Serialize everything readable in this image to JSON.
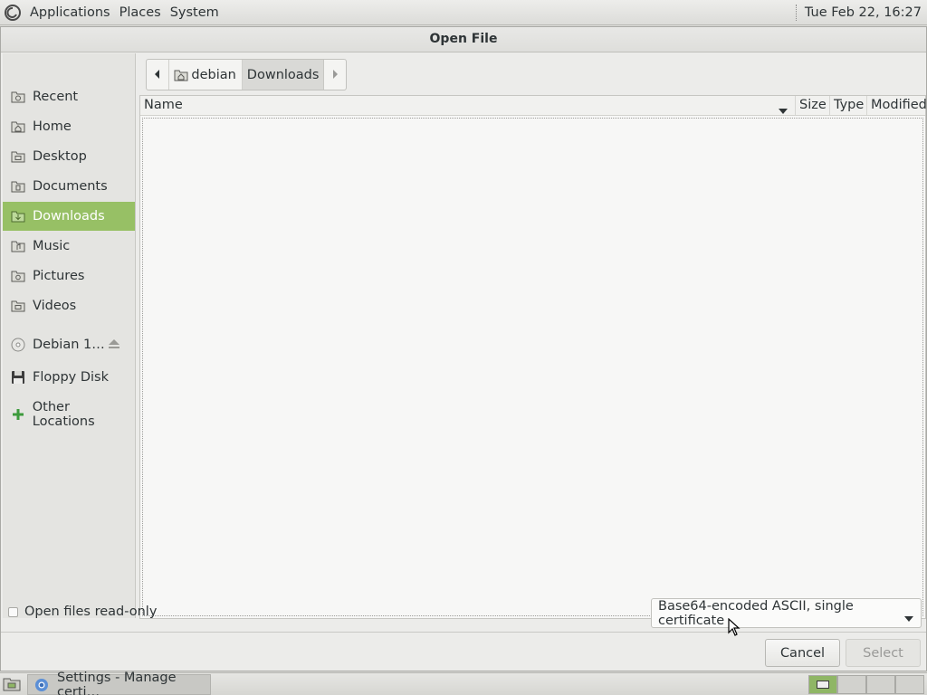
{
  "top_panel": {
    "menus": [
      "Applications",
      "Places",
      "System"
    ],
    "clock": "Tue Feb 22, 16:27"
  },
  "dialog": {
    "title": "Open File",
    "sidebar": {
      "items": [
        {
          "label": "Recent",
          "icon": "recent-folder-icon",
          "active": false
        },
        {
          "label": "Home",
          "icon": "home-folder-icon",
          "active": false
        },
        {
          "label": "Desktop",
          "icon": "desktop-folder-icon",
          "active": false
        },
        {
          "label": "Documents",
          "icon": "documents-folder-icon",
          "active": false
        },
        {
          "label": "Downloads",
          "icon": "downloads-folder-icon",
          "active": true
        },
        {
          "label": "Music",
          "icon": "music-folder-icon",
          "active": false
        },
        {
          "label": "Pictures",
          "icon": "pictures-folder-icon",
          "active": false
        },
        {
          "label": "Videos",
          "icon": "videos-folder-icon",
          "active": false
        },
        {
          "label": "Debian 1…",
          "icon": "optical-disc-icon",
          "active": false
        },
        {
          "label": "Floppy Disk",
          "icon": "floppy-disk-icon",
          "active": false
        },
        {
          "label": "Other Locations",
          "icon": "plus-icon",
          "active": false
        }
      ]
    },
    "pathbar": {
      "crumbs": [
        "debian",
        "Downloads"
      ],
      "current": "Downloads"
    },
    "columns": {
      "name": "Name",
      "size": "Size",
      "type": "Type",
      "modified": "Modified"
    },
    "files": [],
    "read_only_label": "Open files read-only",
    "read_only_checked": false,
    "filter": {
      "selected": "Base64-encoded ASCII, single certificate"
    },
    "buttons": {
      "cancel": "Cancel",
      "select": "Select"
    }
  },
  "taskbar": {
    "tasks": [
      {
        "label": "Settings - Manage certi…",
        "icon": "chromium-icon"
      }
    ]
  },
  "colors": {
    "accent": "#97c065",
    "dialog_bg": "#ececea",
    "list_bg": "#f7f7f6"
  }
}
